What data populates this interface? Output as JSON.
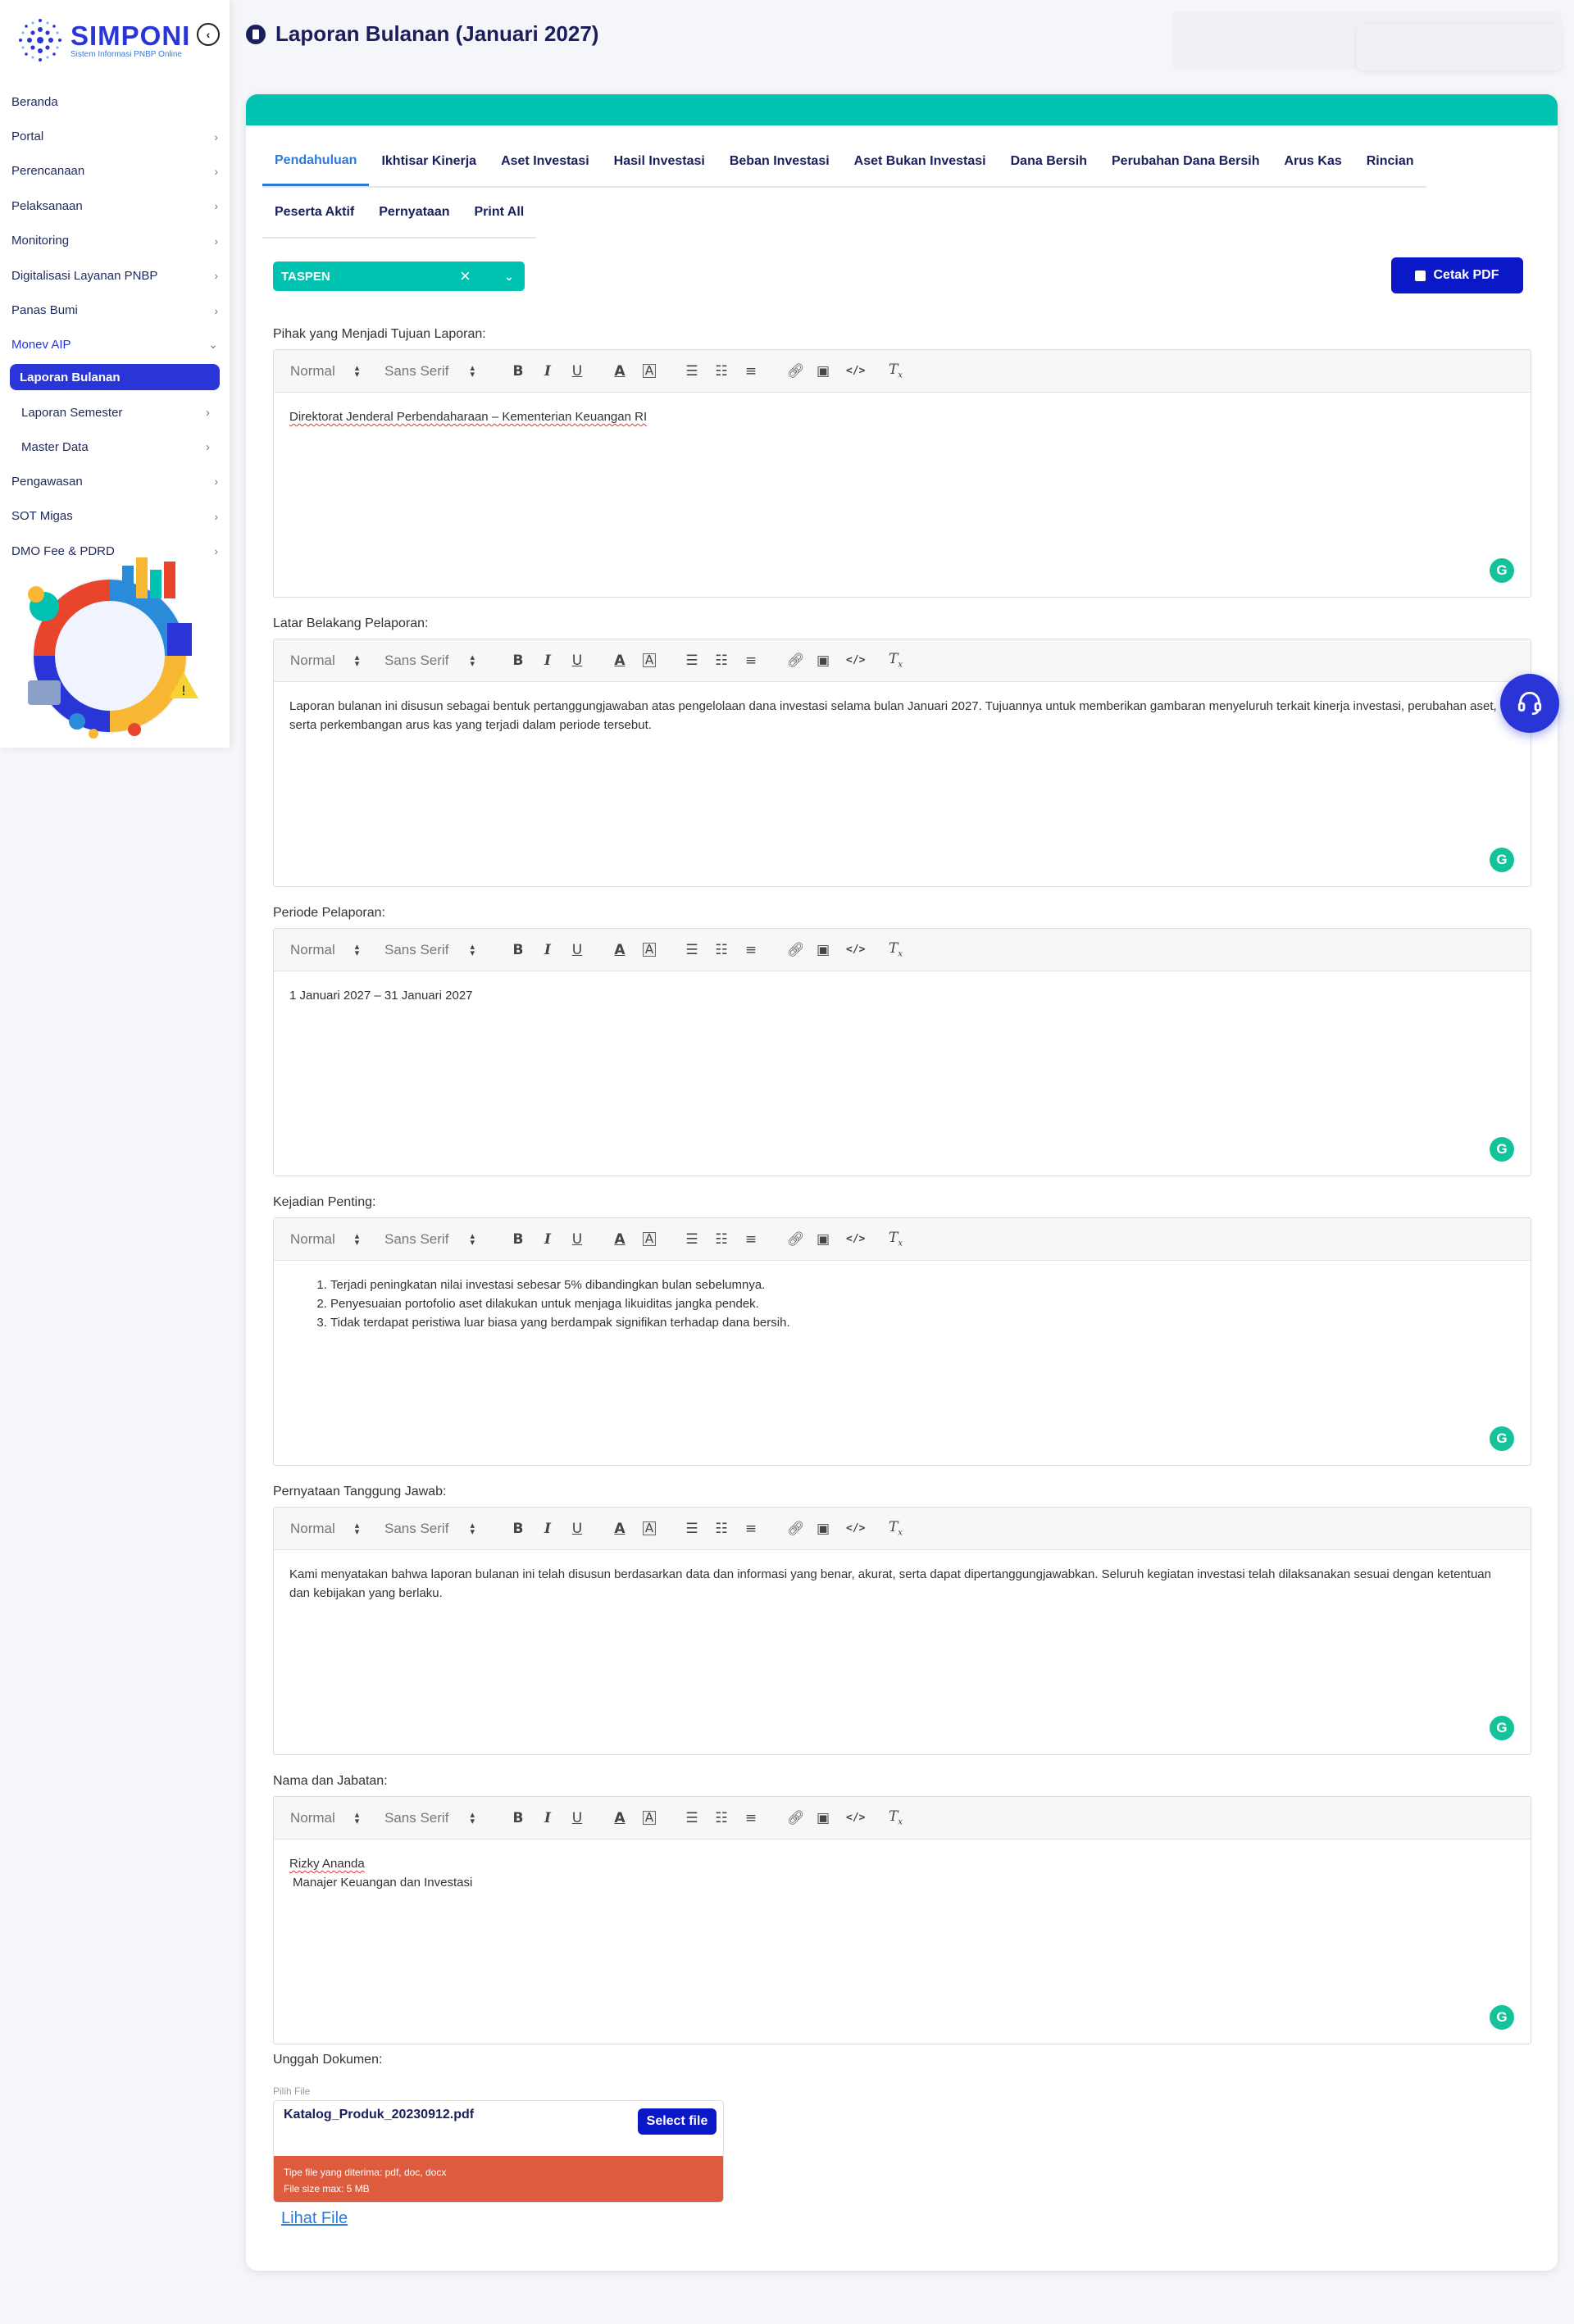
{
  "app": {
    "name": "SIMPONI",
    "subtitle": "Sistem Informasi PNBP Online"
  },
  "sidebar": {
    "items": [
      {
        "label": "Beranda",
        "chevron": false
      },
      {
        "label": "Portal",
        "chevron": true
      },
      {
        "label": "Perencanaan",
        "chevron": true
      },
      {
        "label": "Pelaksanaan",
        "chevron": true
      },
      {
        "label": "Monitoring",
        "chevron": true
      },
      {
        "label": "Digitalisasi Layanan PNBP",
        "chevron": true
      },
      {
        "label": "Panas Bumi",
        "chevron": true
      }
    ],
    "open_group": "Monev AIP",
    "sub_items": [
      {
        "label": "Laporan Bulanan",
        "active": true
      },
      {
        "label": "Laporan Semester",
        "active": false
      },
      {
        "label": "Master Data",
        "active": false
      }
    ],
    "items_after": [
      {
        "label": "Pengawasan"
      },
      {
        "label": "SOT Migas"
      },
      {
        "label": "DMO Fee & PDRD"
      }
    ]
  },
  "page": {
    "title": "Laporan Bulanan (Januari 2027)"
  },
  "tabs_row1": [
    "Pendahuluan",
    "Ikhtisar Kinerja",
    "Aset Investasi",
    "Hasil Investasi",
    "Beban Investasi",
    "Aset Bukan Investasi",
    "Dana Bersih",
    "Perubahan Dana Bersih",
    "Arus Kas",
    "Rincian"
  ],
  "tabs_row2": [
    "Peserta Aktif",
    "Pernyataan",
    "Print All"
  ],
  "active_tab": "Pendahuluan",
  "entity_select": {
    "value": "TASPEN"
  },
  "print_button": "Cetak PDF",
  "toolbar": {
    "format": "Normal",
    "font": "Sans Serif"
  },
  "sections": {
    "pihak": {
      "label": "Pihak yang Menjadi Tujuan Laporan:",
      "text": "Direktorat Jenderal Perbendaharaan – Kementerian Keuangan RI"
    },
    "latar": {
      "label": "Latar Belakang Pelaporan:",
      "text": "Laporan bulanan ini disusun sebagai bentuk pertanggungjawaban atas pengelolaan dana investasi selama bulan Januari 2027. Tujuannya untuk memberikan gambaran menyeluruh terkait kinerja investasi, perubahan aset, serta perkembangan arus kas yang terjadi dalam periode tersebut."
    },
    "periode": {
      "label": "Periode Pelaporan:",
      "text": "1 Januari 2027 – 31 Januari 2027"
    },
    "kejadian": {
      "label": "Kejadian Penting:",
      "list": [
        "Terjadi peningkatan nilai investasi sebesar 5% dibandingkan bulan sebelumnya.",
        "Penyesuaian portofolio aset dilakukan untuk menjaga likuiditas jangka pendek.",
        "Tidak terdapat peristiwa luar biasa yang berdampak signifikan terhadap dana bersih."
      ]
    },
    "pernyataan": {
      "label": "Pernyataan Tanggung Jawab:",
      "text": "Kami menyatakan bahwa laporan bulanan ini telah disusun berdasarkan data dan informasi yang benar, akurat, serta dapat dipertanggungjawabkan. Seluruh kegiatan investasi telah dilaksanakan sesuai dengan ketentuan dan kebijakan yang berlaku."
    },
    "nama": {
      "label": "Nama dan Jabatan:",
      "name": "Rizky Ananda",
      "position": "Manajer Keuangan dan Investasi"
    }
  },
  "upload": {
    "label": "Unggah Dokumen:",
    "field_label": "Pilih File",
    "file_name": "Katalog_Produk_20230912.pdf",
    "select_button": "Select file",
    "accepted": "Tipe file yang diterima: pdf, doc, docx",
    "max_size": "File size max: 5 MB",
    "view_link": "Lihat File"
  },
  "colors": {
    "primary": "#2a35d8",
    "teal": "#00c2b0",
    "button": "#0a18c8",
    "warning": "#dd5c3d"
  }
}
